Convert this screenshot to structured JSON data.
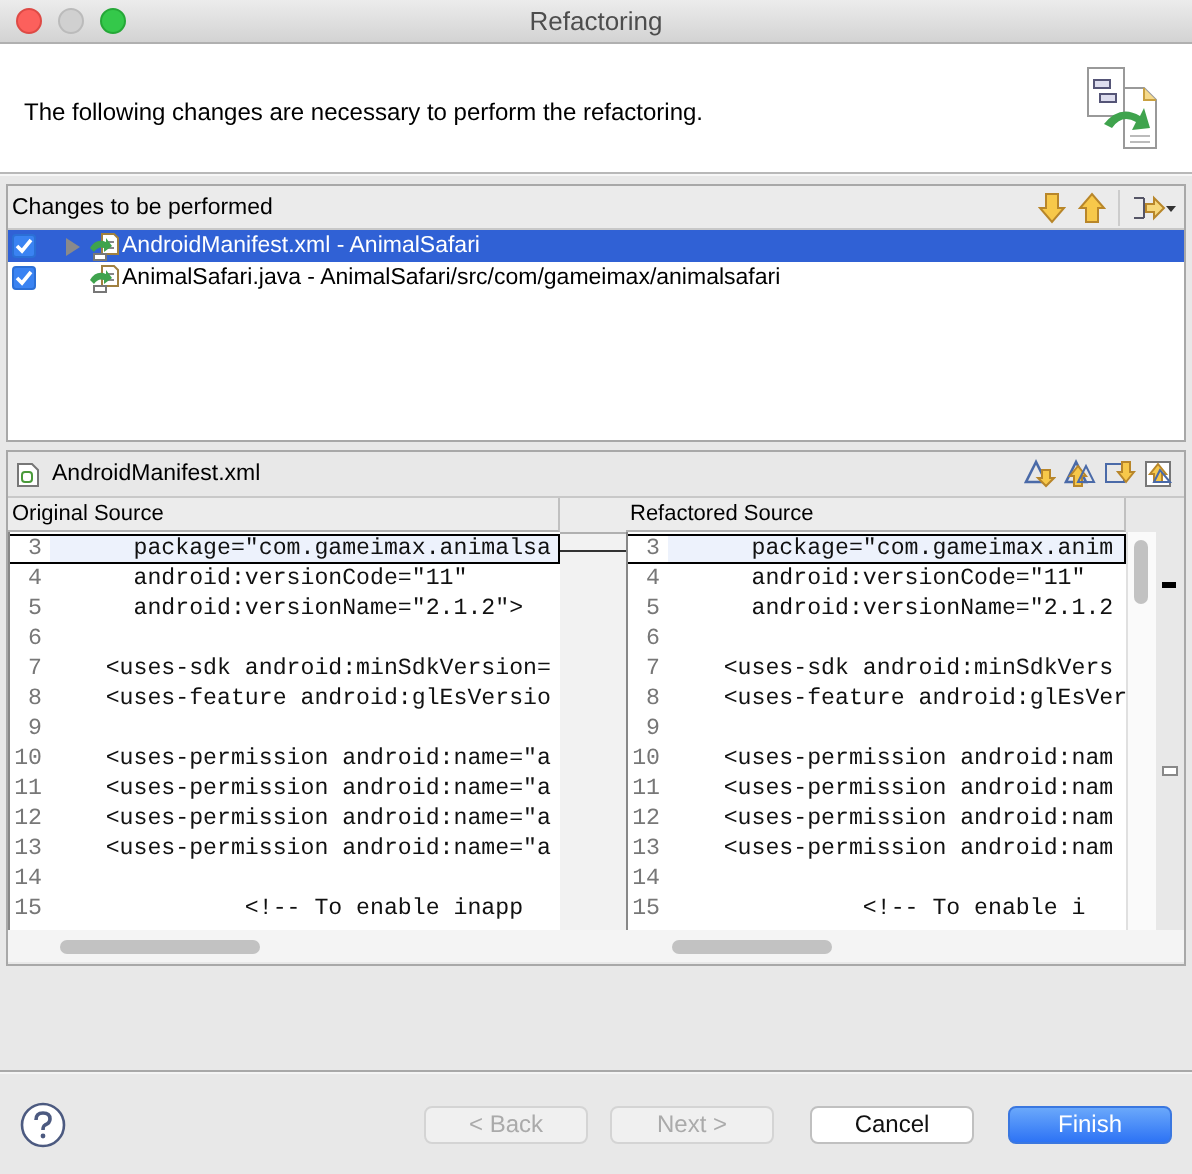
{
  "window": {
    "title": "Refactoring"
  },
  "header": {
    "message": "The following changes are necessary to perform the refactoring."
  },
  "changes": {
    "title": "Changes to be performed",
    "items": [
      {
        "label": "AndroidManifest.xml - AnimalSafari",
        "checked": true,
        "selected": true,
        "expanded": false
      },
      {
        "label": "AnimalSafari.java - AnimalSafari/src/com/gameimax/animalsafari",
        "checked": true,
        "selected": false
      }
    ]
  },
  "compare": {
    "file": "AndroidManifest.xml",
    "panes": [
      {
        "title": "Original Source",
        "lines": [
          {
            "number": "3",
            "text": "      package=\"com.gameimax.animalsa",
            "selected": true
          },
          {
            "number": "4",
            "text": "      android:versionCode=\"11\"",
            "selected": false
          },
          {
            "number": "5",
            "text": "      android:versionName=\"2.1.2\">",
            "selected": false
          },
          {
            "number": "6",
            "selected": false
          },
          {
            "number": "7",
            "text": "    <uses-sdk android:minSdkVersion=",
            "selected": false
          },
          {
            "number": "8",
            "text": "    <uses-feature android:glEsVersio",
            "selected": false
          },
          {
            "number": "9",
            "selected": false
          },
          {
            "number": "10",
            "text": "    <uses-permission android:name=\"a",
            "selected": false
          },
          {
            "number": "11",
            "text": "    <uses-permission android:name=\"a",
            "selected": false
          },
          {
            "number": "12",
            "text": "    <uses-permission android:name=\"a",
            "selected": false
          },
          {
            "number": "13",
            "text": "    <uses-permission android:name=\"a",
            "selected": false
          },
          {
            "number": "14",
            "selected": false
          },
          {
            "number": "15",
            "text": "              <!-- To enable inapp",
            "selected": false
          }
        ]
      },
      {
        "title": "Refactored Source",
        "lines": [
          {
            "number": "3",
            "text": "      package=\"com.gameimax.anim",
            "selected": true
          },
          {
            "number": "4",
            "text": "      android:versionCode=\"11\"",
            "selected": false
          },
          {
            "number": "5",
            "text": "      android:versionName=\"2.1.2",
            "selected": false
          },
          {
            "number": "6",
            "selected": false
          },
          {
            "number": "7",
            "text": "    <uses-sdk android:minSdkVers",
            "selected": false
          },
          {
            "number": "8",
            "text": "    <uses-feature android:glEsVer",
            "selected": false
          },
          {
            "number": "9",
            "selected": false
          },
          {
            "number": "10",
            "text": "    <uses-permission android:nam",
            "selected": false
          },
          {
            "number": "11",
            "text": "    <uses-permission android:nam",
            "selected": false
          },
          {
            "number": "12",
            "text": "    <uses-permission android:nam",
            "selected": false
          },
          {
            "number": "13",
            "text": "    <uses-permission android:nam",
            "selected": false
          },
          {
            "number": "14",
            "selected": false
          },
          {
            "number": "15",
            "text": "              <!-- To enable i",
            "selected": false
          }
        ]
      }
    ]
  },
  "buttons": [
    {
      "label": "< Back",
      "disabled": true,
      "default": false
    },
    {
      "label": "Next >",
      "disabled": true,
      "default": false
    },
    {
      "label": "Cancel",
      "disabled": false,
      "default": false
    },
    {
      "label": "Finish",
      "disabled": false,
      "default": true
    }
  ]
}
